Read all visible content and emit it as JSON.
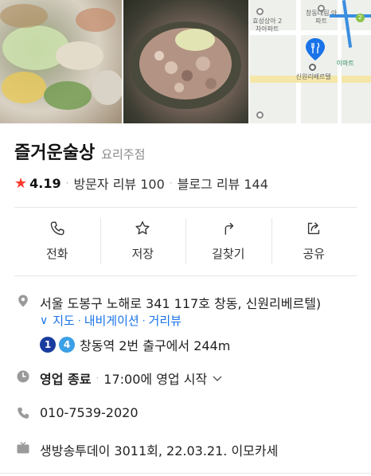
{
  "place": {
    "name": "즐거운술상",
    "category": "요리주점"
  },
  "rating": {
    "score": "4.19",
    "visitor_reviews": "방문자 리뷰 100",
    "blog_reviews": "블로그 리뷰 144"
  },
  "actions": [
    {
      "label": "전화",
      "icon": "phone-icon"
    },
    {
      "label": "저장",
      "icon": "star-icon"
    },
    {
      "label": "길찾기",
      "icon": "directions-icon"
    },
    {
      "label": "공유",
      "icon": "share-icon"
    }
  ],
  "map_preview": {
    "labels": [
      "창동대림 아파트",
      "효성상아 2차아파트",
      "신원리베르텔",
      "이마트"
    ],
    "metro_badge": "2"
  },
  "address": {
    "text": "서울 도봉구 노해로 341 117호 창동, 신원리베르텔)",
    "links": [
      "지도",
      "내비게이션",
      "거리뷰"
    ]
  },
  "subway": {
    "lines": [
      "1",
      "4"
    ],
    "text": "창동역 2번 출구에서 244m"
  },
  "hours": {
    "status": "영업 종료",
    "next": "17:00에 영업 시작"
  },
  "phone": "010-7539-2020",
  "tv": "생방송투데이 3011회, 22.03.21. 이모카세",
  "colors": {
    "accent_red": "#ff3b30",
    "link_blue": "#1a73e8",
    "line1": "#1a3c9e",
    "line4": "#3ba0e6"
  }
}
